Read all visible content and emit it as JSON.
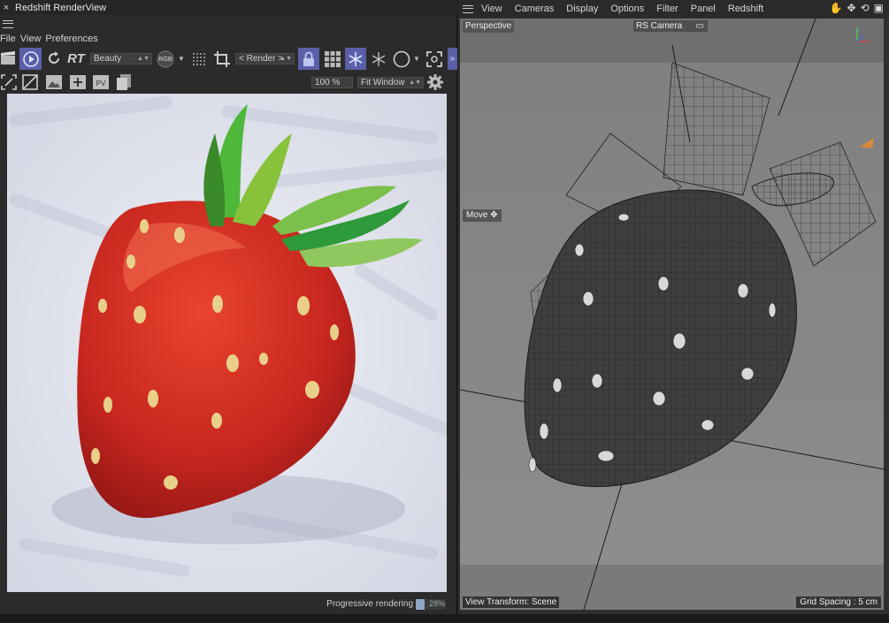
{
  "render_view": {
    "title": "Redshift RenderView",
    "close_glyph": "×",
    "menu": [
      "File",
      "View",
      "Preferences"
    ],
    "toolbar": {
      "rt_label": "RT",
      "aov_value": "Beauty",
      "rgb_label": "RGB",
      "render_mode_value": "< Render >",
      "zoom_value": "100 %",
      "fit_value": "Fit Window"
    },
    "status": {
      "label": "Progressive rendering",
      "progress_text": "28%",
      "progress_fraction": 0.28
    }
  },
  "viewport": {
    "menu": [
      "View",
      "Cameras",
      "Display",
      "Options",
      "Filter",
      "Panel",
      "Redshift"
    ],
    "view_label": "Perspective",
    "camera_label": "RS Camera",
    "tool_label": "Move",
    "view_transform": "View Transform: Scene",
    "grid_spacing": "Grid Spacing : 5 cm"
  },
  "colors": {
    "accent": "#5a5fa8",
    "strawberry_red": "#c8271f",
    "leaf_green": "#4fb83a"
  }
}
